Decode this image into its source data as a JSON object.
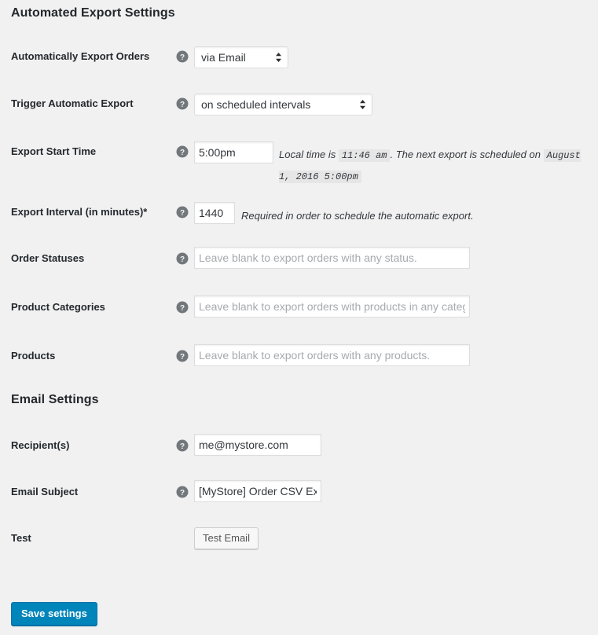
{
  "sections": {
    "automated": {
      "heading": "Automated Export Settings"
    },
    "email": {
      "heading": "Email Settings"
    }
  },
  "rows": {
    "export_orders": {
      "label": "Automatically Export Orders",
      "help_icon": "help-icon",
      "value": "via Email"
    },
    "export_trigger": {
      "label": "Trigger Automatic Export",
      "help_icon": "help-icon",
      "value": "on scheduled intervals"
    },
    "start_time": {
      "label": "Export Start Time",
      "help_icon": "help-icon",
      "value": "5:00pm",
      "desc_part1": "Local time is",
      "desc_code1": "11:46 am",
      "desc_part2": ". The next export is scheduled on",
      "desc_code2": "August 1, 2016 5:00pm"
    },
    "interval": {
      "label": "Export Interval (in minutes)*",
      "help_icon": "help-icon",
      "value": "1440",
      "description": "Required in order to schedule the automatic export."
    },
    "order_statuses": {
      "label": "Order Statuses",
      "help_icon": "help-icon",
      "value": "",
      "placeholder": "Leave blank to export orders with any status."
    },
    "product_categories": {
      "label": "Product Categories",
      "help_icon": "help-icon",
      "value": "",
      "placeholder": "Leave blank to export orders with products in any category."
    },
    "products": {
      "label": "Products",
      "help_icon": "help-icon",
      "value": "",
      "placeholder": "Leave blank to export orders with any products."
    },
    "recipients": {
      "label": "Recipient(s)",
      "help_icon": "help-icon",
      "value": "me@mystore.com",
      "placeholder": ""
    },
    "email_subject": {
      "label": "Email Subject",
      "help_icon": "help-icon",
      "value": "[MyStore] Order CSV Export",
      "placeholder": ""
    },
    "test": {
      "label": "Test",
      "button_label": "Test Email"
    }
  },
  "actions": {
    "save_label": "Save settings"
  },
  "colors": {
    "page_background": "#f1f1f1",
    "label_text": "#23282d",
    "primary_button": "#0085ba",
    "primary_button_border": "#0073aa",
    "input_border": "#dddddd",
    "code_background": "#e6e6e6",
    "placeholder_text": "#a7aaad",
    "help_icon_fill": "#72777c"
  }
}
